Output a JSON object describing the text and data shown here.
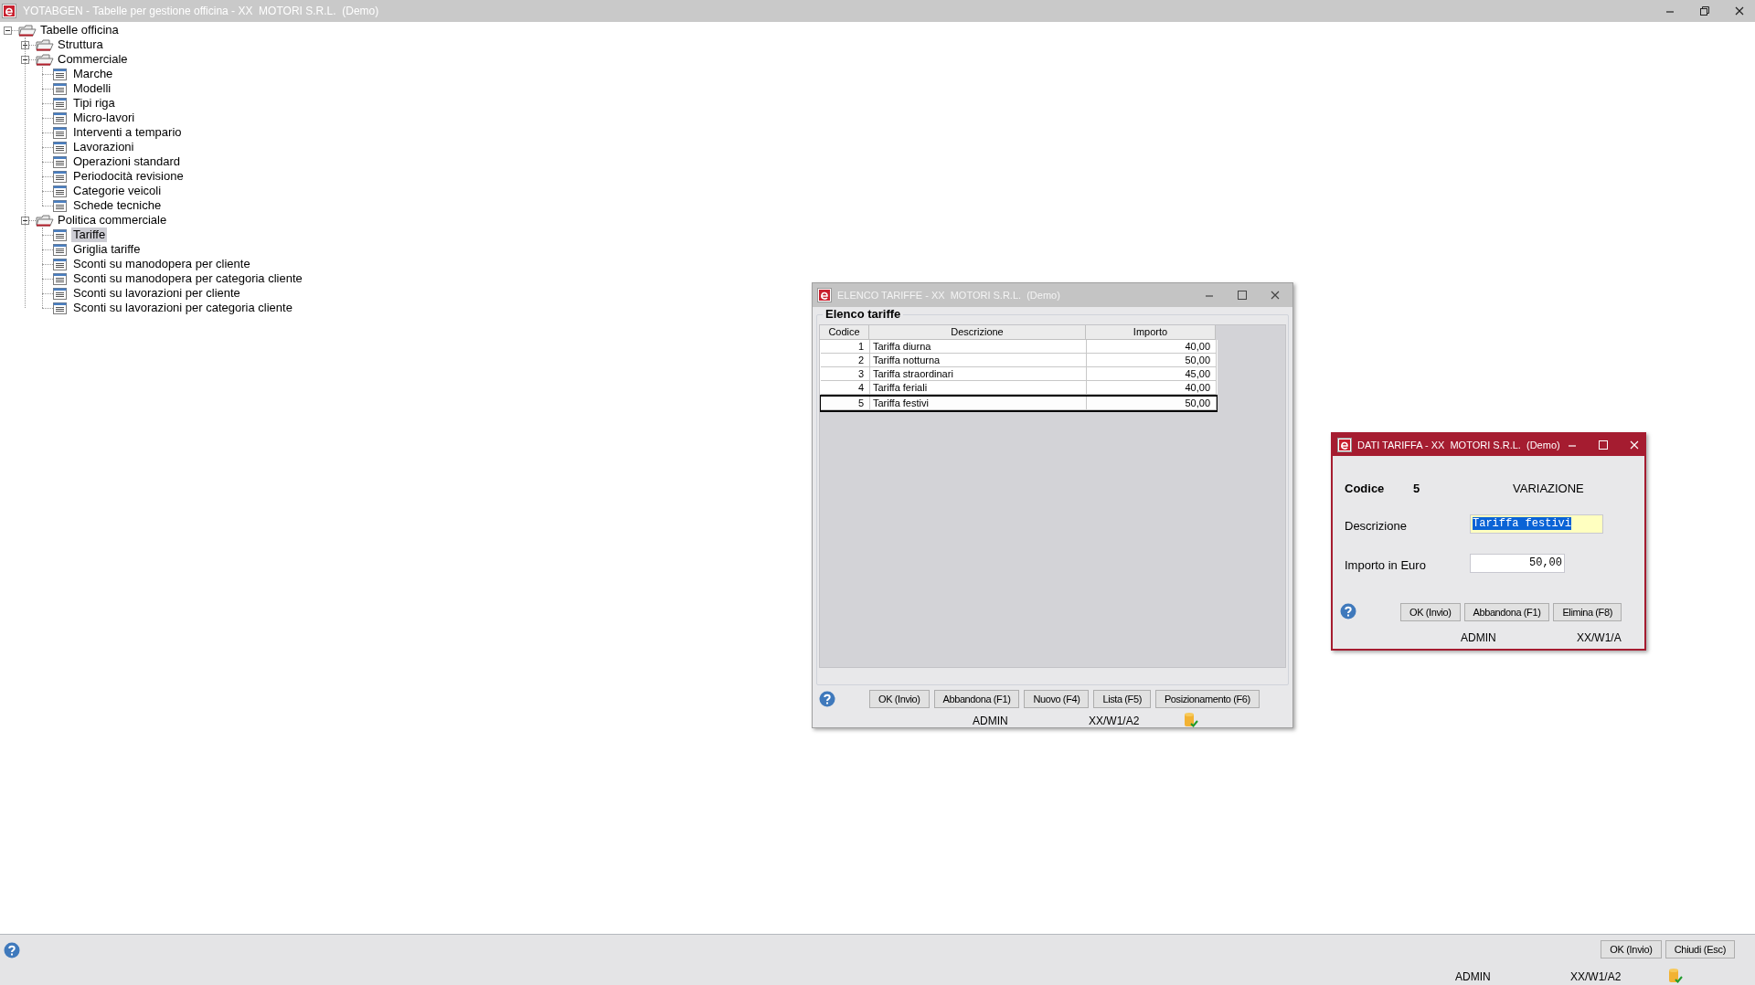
{
  "window": {
    "title": "YOTABGEN - Tabelle per gestione officina - XX  MOTORI S.R.L.  (Demo)"
  },
  "tree": [
    {
      "label": "Tabelle officina",
      "kind": "folder",
      "expanded": true,
      "children": [
        {
          "label": "Struttura",
          "kind": "folder",
          "expanded": false
        },
        {
          "label": "Commerciale",
          "kind": "folder",
          "expanded": true,
          "children": [
            {
              "label": "Marche",
              "kind": "leaf",
              "selected": false
            },
            {
              "label": "Modelli",
              "kind": "leaf",
              "selected": false
            },
            {
              "label": "Tipi riga",
              "kind": "leaf",
              "selected": false
            },
            {
              "label": "Micro-lavori",
              "kind": "leaf",
              "selected": false
            },
            {
              "label": "Interventi a tempario",
              "kind": "leaf",
              "selected": false
            },
            {
              "label": "Lavorazioni",
              "kind": "leaf",
              "selected": false
            },
            {
              "label": "Operazioni standard",
              "kind": "leaf",
              "selected": false
            },
            {
              "label": "Periodocità revisione",
              "kind": "leaf",
              "selected": false
            },
            {
              "label": "Categorie veicoli",
              "kind": "leaf",
              "selected": false
            },
            {
              "label": "Schede tecniche",
              "kind": "leaf",
              "selected": false
            }
          ]
        },
        {
          "label": "Politica commerciale",
          "kind": "folder",
          "expanded": true,
          "children": [
            {
              "label": "Tariffe",
              "kind": "leaf",
              "selected": true
            },
            {
              "label": "Griglia tariffe",
              "kind": "leaf",
              "selected": false
            },
            {
              "label": "Sconti su manodopera per cliente",
              "kind": "leaf",
              "selected": false
            },
            {
              "label": "Sconti su manodopera per categoria cliente",
              "kind": "leaf",
              "selected": false
            },
            {
              "label": "Sconti su lavorazioni per cliente",
              "kind": "leaf",
              "selected": false
            },
            {
              "label": "Sconti su lavorazioni per categoria cliente",
              "kind": "leaf",
              "selected": false
            }
          ]
        }
      ]
    }
  ],
  "list_window": {
    "title": "ELENCO TARIFFE - XX  MOTORI S.R.L.  (Demo)",
    "active": false,
    "group_title": "Elenco tariffe",
    "table": {
      "columns": [
        "Codice",
        "Descrizione",
        "Importo"
      ],
      "rows": [
        {
          "cells": [
            "1",
            "Tariffa diurna",
            "40,00"
          ],
          "selected": false
        },
        {
          "cells": [
            "2",
            "Tariffa notturna",
            "50,00"
          ],
          "selected": false
        },
        {
          "cells": [
            "3",
            "Tariffa straordinari",
            "45,00"
          ],
          "selected": false
        },
        {
          "cells": [
            "4",
            "Tariffa feriali",
            "40,00"
          ],
          "selected": false
        },
        {
          "cells": [
            "5",
            "Tariffa festivi",
            "50,00"
          ],
          "selected": true
        }
      ]
    },
    "buttons": [
      "OK (Invio)",
      "Abbandona (F1)",
      "Nuovo (F4)",
      "Lista (F5)",
      "Posizionamento (F6)"
    ],
    "status": {
      "user": "ADMIN",
      "station": "XX/W1/A2"
    }
  },
  "detail_window": {
    "title": "DATI TARIFFA - XX  MOTORI S.R.L.  (Demo)",
    "active": true,
    "code_label": "Codice",
    "code": "5",
    "mode": "VARIAZIONE",
    "fields": [
      {
        "label": "Descrizione",
        "value": "Tariffa festivi",
        "focused": true
      },
      {
        "label": "Importo in Euro",
        "value": "50,00",
        "focused": false
      }
    ],
    "buttons": [
      "OK (Invio)",
      "Abbandona (F1)",
      "Elimina (F8)"
    ],
    "status": {
      "user": "ADMIN",
      "station": "XX/W1/A"
    }
  },
  "main_buttons": [
    "OK (Invio)",
    "Chiudi (Esc)"
  ],
  "status_bar": {
    "user": "ADMIN",
    "station": "XX/W1/A2"
  }
}
